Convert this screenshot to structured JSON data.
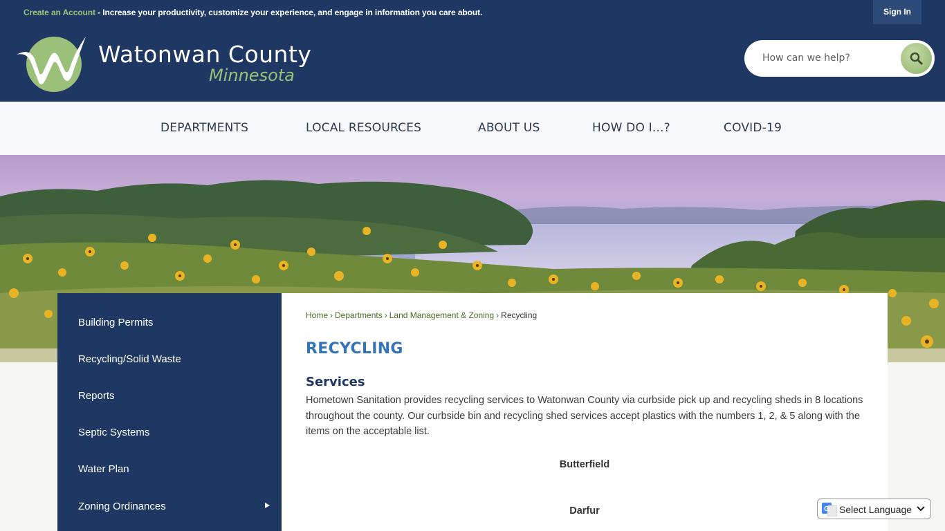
{
  "topbar": {
    "create_account": "Create an Account",
    "message": " - Increase your productivity, customize your experience, and engage in information you care about.",
    "sign_in": "Sign In"
  },
  "header": {
    "title": "Watonwan County",
    "subtitle": "Minnesota",
    "search_placeholder": "How can we help?"
  },
  "nav": {
    "items": [
      "DEPARTMENTS",
      "LOCAL RESOURCES",
      "ABOUT US",
      "HOW DO I...?",
      "COVID-19"
    ]
  },
  "sidebar": {
    "items": [
      "Building Permits",
      "Recycling/Solid Waste",
      "Reports",
      "Septic Systems",
      "Water Plan",
      "Zoning Ordinances"
    ]
  },
  "breadcrumb": {
    "home": "Home",
    "departments": "Departments",
    "land": "Land Management & Zoning",
    "current": "Recycling"
  },
  "main": {
    "title": "RECYCLING",
    "section_heading": "Services",
    "body": "Hometown Sanitation provides recycling services to Watonwan County via curbside pick up and recycling sheds in 8 locations throughout the county. Our curbside bin and recycling shed services accept plastics with the numbers 1, 2, & 5 along with the items on the acceptable list.",
    "locations": [
      "Butterfield",
      "Darfur"
    ]
  },
  "language": {
    "label": "Select Language"
  },
  "colors": {
    "navy": "#1f3863",
    "green": "#9bc07a",
    "title_blue": "#3574b7"
  }
}
